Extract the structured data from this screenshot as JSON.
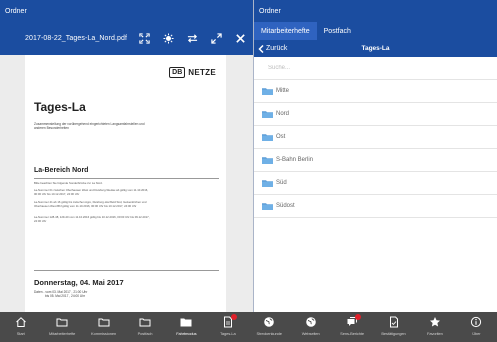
{
  "left": {
    "header_title": "Ordner",
    "file_name": "2017-08-22_Tages-La_Nord.pdf",
    "tools": [
      "expand-icon",
      "brightness-icon",
      "swap-icon",
      "fullscreen-icon",
      "close-icon"
    ]
  },
  "document": {
    "logo_db": "DB",
    "logo_netze": "NETZE",
    "title": "Tages-La",
    "subtitle": "Zusammenstellung der vorübergehend eingerichteten Langsamfahrstellen und anderen Besonderheiten",
    "section_title": "La-Bereich Nord",
    "para1": "Bitte beachten Sie folgende Sonderbrücke zur La Nord.",
    "para2": "La-Nummer 01 zwischen Oberhausen West und Duisburg-Wedau ab gültig vom 11.10.2016, 00:00 Uhr bis 10.12.2017, 24:00 Uhr",
    "para3": "La-Nummer 41 ab 16 gültig bis zwischen Agro, Duisburg-Hochfeld Süd, Gelsenkirchen und Oberhausen West Bbf gültig vom 11.10.2016, 00:00 Uhr bis 10.12.2017, 24:00 Uhr",
    "para4": "La-Nummer 128-48, 129-40 vom 11.10.2016 gültig bis 10.12.2016, 00:00 Uhr bis 09.12.2017, 24:00 Uhr",
    "date_title": "Donnerstag, 04. Mai 2017",
    "date_from": "Daten - vom 03. Mai 2017 , 21:00 Uhr",
    "date_to": "bis 05. Mai 2017 , 24:00 Uhr"
  },
  "right": {
    "header_title": "Ordner",
    "tabs": [
      {
        "label": "Mitarbeiterhefte",
        "active": true
      },
      {
        "label": "Postfach",
        "active": false
      }
    ],
    "back_label": "Zurück",
    "nav_title": "Tages-La",
    "search_placeholder": "Suche...",
    "folders": [
      "Mitte",
      "Nord",
      "Ost",
      "S-Bahn Berlin",
      "Süd",
      "Südost"
    ]
  },
  "bottom": {
    "items": [
      {
        "label": "Start",
        "icon": "home-icon",
        "active": false,
        "badge": false
      },
      {
        "label": "Mitarbeiterhefte",
        "icon": "folder-icon",
        "active": false,
        "badge": false
      },
      {
        "label": "Kommissionen",
        "icon": "folder-icon",
        "active": false,
        "badge": false
      },
      {
        "label": "Postfach",
        "icon": "folder-icon",
        "active": false,
        "badge": false
      },
      {
        "label": "Fahrtmodus",
        "icon": "folder-filled-icon",
        "active": true,
        "badge": false
      },
      {
        "label": "Tages-La",
        "icon": "document-icon",
        "active": false,
        "badge": true
      },
      {
        "label": "Streckenkunde",
        "icon": "globe-icon",
        "active": false,
        "badge": false
      },
      {
        "label": "Webseiten",
        "icon": "globe-icon",
        "active": false,
        "badge": false
      },
      {
        "label": "Sens-Berichte",
        "icon": "chat-icon",
        "active": false,
        "badge": true
      },
      {
        "label": "Bestätigungen",
        "icon": "check-document-icon",
        "active": false,
        "badge": false
      },
      {
        "label": "Favoriten",
        "icon": "star-icon",
        "active": false,
        "badge": false
      },
      {
        "label": "Über",
        "icon": "info-icon",
        "active": false,
        "badge": false
      }
    ]
  },
  "colors": {
    "header_blue": "#1b4da0",
    "active_tab": "#2f63c0",
    "folder_icon": "#5b9bd5",
    "bottom_bar": "#4a4a4a",
    "badge_red": "#e0202a"
  }
}
